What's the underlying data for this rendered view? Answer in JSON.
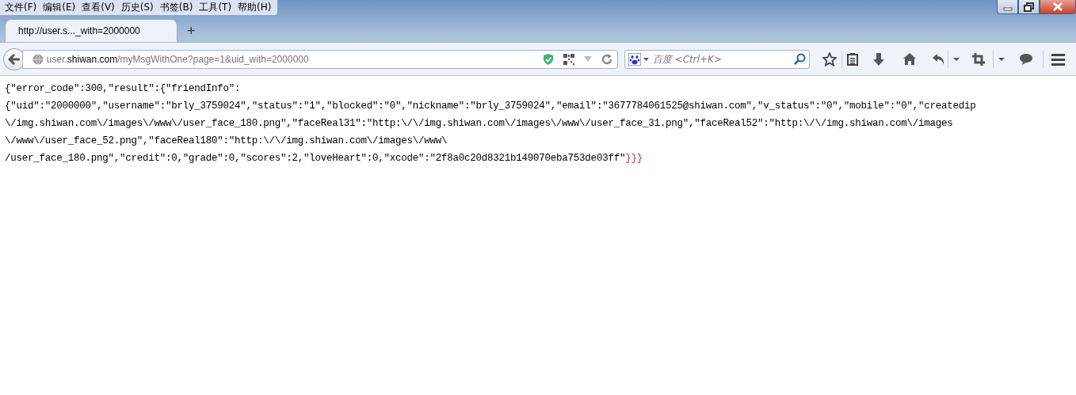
{
  "menu_bar": {
    "items": [
      "文件(F)",
      "编辑(E)",
      "查看(V)",
      "历史(S)",
      "书签(B)",
      "工具(T)",
      "帮助(H)"
    ]
  },
  "tabs": [
    {
      "label": "http://user.s..._with=2000000",
      "selected": true
    }
  ],
  "new_tab": "+",
  "address_bar": {
    "prefix": "user.",
    "domain": "shiwan.com",
    "path": "/myMsgWithOne?page=1&uid_with=2000000"
  },
  "search_box": {
    "placeholder": "百度 <Ctrl+K>"
  },
  "content": {
    "lines": [
      "{\"error_code\":300,\"result\":{\"friendInfo\":",
      "{\"uid\":\"2000000\",\"username\":\"brly_3759024\",\"status\":\"1\",\"blocked\":\"0\",\"nickname\":\"brly_3759024\",\"email\":\"3677784061525@shiwan.com\",\"v_status\":\"0\",\"mobile\":\"0\",\"createdip",
      "\\/img.shiwan.com\\/images\\/www\\/user_face_180.png\",\"faceReal31\":\"http:\\/\\/img.shiwan.com\\/images\\/www\\/user_face_31.png\",\"faceReal52\":\"http:\\/\\/img.shiwan.com\\/images",
      "\\/www\\/user_face_52.png\",\"faceReal180\":\"http:\\/\\/img.shiwan.com\\/images\\/www\\",
      "/user_face_180.png\",\"credit\":0,\"grade\":0,\"scores\":2,\"loveHeart\":0,\"xcode\":\"2f8a0c20d8321b149070eba753de03ff\""
    ],
    "closing": "}}}"
  }
}
